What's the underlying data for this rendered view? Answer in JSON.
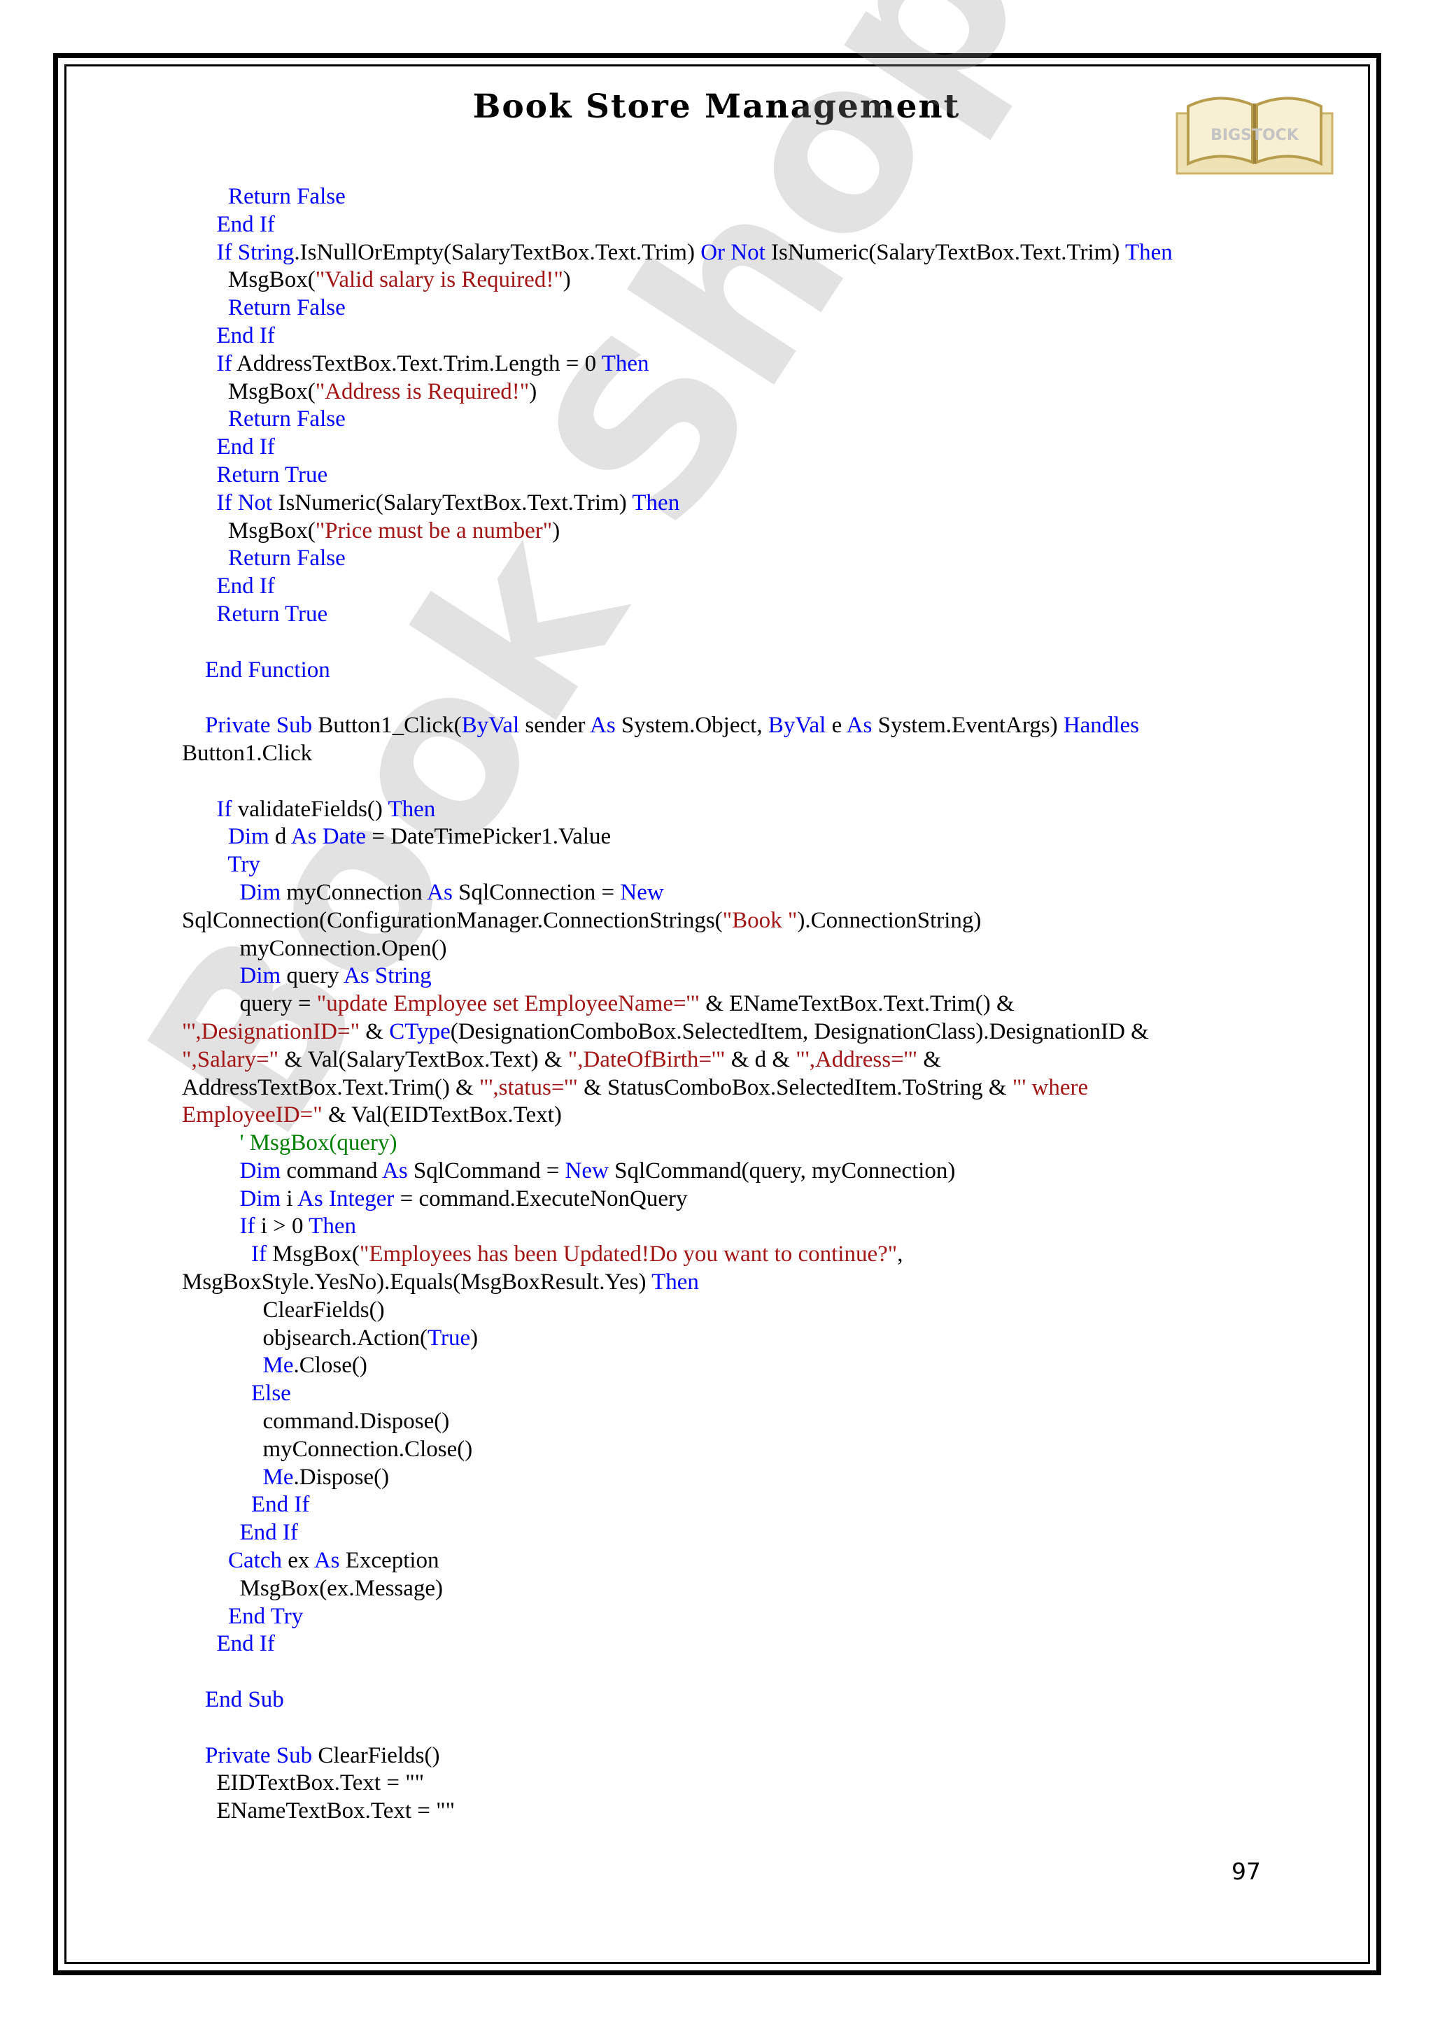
{
  "header": {
    "title": "Book Store Management",
    "logo_text": "BIGSTOCK"
  },
  "watermark": "Book Shop Mgt",
  "page_number": "97",
  "colors": {
    "keyword": "#0000ff",
    "string": "#a31515",
    "comment": "#008000",
    "text": "#000000"
  },
  "code_lines": [
    [
      {
        "t": "        "
      },
      {
        "t": "Return False",
        "c": "kw"
      }
    ],
    [
      {
        "t": "      "
      },
      {
        "t": "End If",
        "c": "kw"
      }
    ],
    [
      {
        "t": "      "
      },
      {
        "t": "If String",
        "c": "kw"
      },
      {
        "t": ".IsNullOrEmpty(SalaryTextBox.Text.Trim) "
      },
      {
        "t": "Or Not",
        "c": "kw"
      },
      {
        "t": " IsNumeric(SalaryTextBox.Text.Trim) "
      },
      {
        "t": "Then",
        "c": "kw"
      }
    ],
    [
      {
        "t": "        MsgBox("
      },
      {
        "t": "\"Valid salary is Required!\"",
        "c": "str"
      },
      {
        "t": ")"
      }
    ],
    [
      {
        "t": "        "
      },
      {
        "t": "Return False",
        "c": "kw"
      }
    ],
    [
      {
        "t": "      "
      },
      {
        "t": "End If",
        "c": "kw"
      }
    ],
    [
      {
        "t": "      "
      },
      {
        "t": "If",
        "c": "kw"
      },
      {
        "t": " AddressTextBox.Text.Trim.Length = 0 "
      },
      {
        "t": "Then",
        "c": "kw"
      }
    ],
    [
      {
        "t": "        MsgBox("
      },
      {
        "t": "\"Address is Required!\"",
        "c": "str"
      },
      {
        "t": ")"
      }
    ],
    [
      {
        "t": "        "
      },
      {
        "t": "Return False",
        "c": "kw"
      }
    ],
    [
      {
        "t": "      "
      },
      {
        "t": "End If",
        "c": "kw"
      }
    ],
    [
      {
        "t": "      "
      },
      {
        "t": "Return True",
        "c": "kw"
      }
    ],
    [
      {
        "t": "      "
      },
      {
        "t": "If Not",
        "c": "kw"
      },
      {
        "t": " IsNumeric(SalaryTextBox.Text.Trim) "
      },
      {
        "t": "Then",
        "c": "kw"
      }
    ],
    [
      {
        "t": "        MsgBox("
      },
      {
        "t": "\"Price must be a number\"",
        "c": "str"
      },
      {
        "t": ")"
      }
    ],
    [
      {
        "t": "        "
      },
      {
        "t": "Return False",
        "c": "kw"
      }
    ],
    [
      {
        "t": "      "
      },
      {
        "t": "End If",
        "c": "kw"
      }
    ],
    [
      {
        "t": "      "
      },
      {
        "t": "Return True",
        "c": "kw"
      }
    ],
    [
      {
        "t": ""
      }
    ],
    [
      {
        "t": "    "
      },
      {
        "t": "End Function",
        "c": "kw"
      }
    ],
    [
      {
        "t": ""
      }
    ],
    [
      {
        "t": "    "
      },
      {
        "t": "Private Sub",
        "c": "kw"
      },
      {
        "t": " Button1_Click("
      },
      {
        "t": "ByVal",
        "c": "kw"
      },
      {
        "t": " sender "
      },
      {
        "t": "As",
        "c": "kw"
      },
      {
        "t": " System.Object, "
      },
      {
        "t": "ByVal",
        "c": "kw"
      },
      {
        "t": " e "
      },
      {
        "t": "As",
        "c": "kw"
      },
      {
        "t": " System.EventArgs) "
      },
      {
        "t": "Handles",
        "c": "kw"
      }
    ],
    [
      {
        "t": "Button1.Click"
      }
    ],
    [
      {
        "t": ""
      }
    ],
    [
      {
        "t": "      "
      },
      {
        "t": "If",
        "c": "kw"
      },
      {
        "t": " validateFields() "
      },
      {
        "t": "Then",
        "c": "kw"
      }
    ],
    [
      {
        "t": "        "
      },
      {
        "t": "Dim",
        "c": "kw"
      },
      {
        "t": " d "
      },
      {
        "t": "As Date",
        "c": "kw"
      },
      {
        "t": " = DateTimePicker1.Value"
      }
    ],
    [
      {
        "t": "        "
      },
      {
        "t": "Try",
        "c": "kw"
      }
    ],
    [
      {
        "t": "          "
      },
      {
        "t": "Dim",
        "c": "kw"
      },
      {
        "t": " myConnection "
      },
      {
        "t": "As",
        "c": "kw"
      },
      {
        "t": " SqlConnection = "
      },
      {
        "t": "New",
        "c": "kw"
      }
    ],
    [
      {
        "t": "SqlConnection(ConfigurationManager.ConnectionStrings("
      },
      {
        "t": "\"Book \"",
        "c": "str"
      },
      {
        "t": ").ConnectionString)"
      }
    ],
    [
      {
        "t": "          myConnection.Open()"
      }
    ],
    [
      {
        "t": "          "
      },
      {
        "t": "Dim",
        "c": "kw"
      },
      {
        "t": " query "
      },
      {
        "t": "As String",
        "c": "kw"
      }
    ],
    [
      {
        "t": "          query = "
      },
      {
        "t": "\"update Employee set EmployeeName='\"",
        "c": "str"
      },
      {
        "t": " & ENameTextBox.Text.Trim() &"
      }
    ],
    [
      {
        "t": "\"',DesignationID=\"",
        "c": "str"
      },
      {
        "t": " & "
      },
      {
        "t": "CType",
        "c": "kw"
      },
      {
        "t": "(DesignationComboBox.SelectedItem, DesignationClass).DesignationID &"
      }
    ],
    [
      {
        "t": "\",Salary=\"",
        "c": "str"
      },
      {
        "t": " & Val(SalaryTextBox.Text) & "
      },
      {
        "t": "\",DateOfBirth='\"",
        "c": "str"
      },
      {
        "t": " & d & "
      },
      {
        "t": "\"',Address='\"",
        "c": "str"
      },
      {
        "t": " &"
      }
    ],
    [
      {
        "t": "AddressTextBox.Text.Trim() & "
      },
      {
        "t": "\"',status='\"",
        "c": "str"
      },
      {
        "t": " & StatusComboBox.SelectedItem.ToString & "
      },
      {
        "t": "\"' where",
        "c": "str"
      }
    ],
    [
      {
        "t": "EmployeeID=\"",
        "c": "str"
      },
      {
        "t": " & Val(EIDTextBox.Text)"
      }
    ],
    [
      {
        "t": "          "
      },
      {
        "t": "' MsgBox(query)",
        "c": "cm"
      }
    ],
    [
      {
        "t": "          "
      },
      {
        "t": "Dim",
        "c": "kw"
      },
      {
        "t": " command "
      },
      {
        "t": "As",
        "c": "kw"
      },
      {
        "t": " SqlCommand = "
      },
      {
        "t": "New",
        "c": "kw"
      },
      {
        "t": " SqlCommand(query, myConnection)"
      }
    ],
    [
      {
        "t": "          "
      },
      {
        "t": "Dim",
        "c": "kw"
      },
      {
        "t": " i "
      },
      {
        "t": "As Integer",
        "c": "kw"
      },
      {
        "t": " = command.ExecuteNonQuery"
      }
    ],
    [
      {
        "t": "          "
      },
      {
        "t": "If",
        "c": "kw"
      },
      {
        "t": " i > 0 "
      },
      {
        "t": "Then",
        "c": "kw"
      }
    ],
    [
      {
        "t": "            "
      },
      {
        "t": "If",
        "c": "kw"
      },
      {
        "t": " MsgBox("
      },
      {
        "t": "\"Employees has been Updated!Do you want to continue?\"",
        "c": "str"
      },
      {
        "t": ","
      }
    ],
    [
      {
        "t": "MsgBoxStyle.YesNo).Equals(MsgBoxResult.Yes) "
      },
      {
        "t": "Then",
        "c": "kw"
      }
    ],
    [
      {
        "t": "              ClearFields()"
      }
    ],
    [
      {
        "t": "              objsearch.Action("
      },
      {
        "t": "True",
        "c": "kw"
      },
      {
        "t": ")"
      }
    ],
    [
      {
        "t": "              "
      },
      {
        "t": "Me",
        "c": "kw"
      },
      {
        "t": ".Close()"
      }
    ],
    [
      {
        "t": "            "
      },
      {
        "t": "Else",
        "c": "kw"
      }
    ],
    [
      {
        "t": "              command.Dispose()"
      }
    ],
    [
      {
        "t": "              myConnection.Close()"
      }
    ],
    [
      {
        "t": "              "
      },
      {
        "t": "Me",
        "c": "kw"
      },
      {
        "t": ".Dispose()"
      }
    ],
    [
      {
        "t": "            "
      },
      {
        "t": "End If",
        "c": "kw"
      }
    ],
    [
      {
        "t": "          "
      },
      {
        "t": "End If",
        "c": "kw"
      }
    ],
    [
      {
        "t": "        "
      },
      {
        "t": "Catch",
        "c": "kw"
      },
      {
        "t": " ex "
      },
      {
        "t": "As",
        "c": "kw"
      },
      {
        "t": " Exception"
      }
    ],
    [
      {
        "t": "          MsgBox(ex.Message)"
      }
    ],
    [
      {
        "t": "        "
      },
      {
        "t": "End Try",
        "c": "kw"
      }
    ],
    [
      {
        "t": "      "
      },
      {
        "t": "End If",
        "c": "kw"
      }
    ],
    [
      {
        "t": ""
      }
    ],
    [
      {
        "t": "    "
      },
      {
        "t": "End Sub",
        "c": "kw"
      }
    ],
    [
      {
        "t": ""
      }
    ],
    [
      {
        "t": "    "
      },
      {
        "t": "Private Sub",
        "c": "kw"
      },
      {
        "t": " ClearFields()"
      }
    ],
    [
      {
        "t": "      EIDTextBox.Text = \"\""
      }
    ],
    [
      {
        "t": "      ENameTextBox.Text = \"\""
      }
    ]
  ]
}
